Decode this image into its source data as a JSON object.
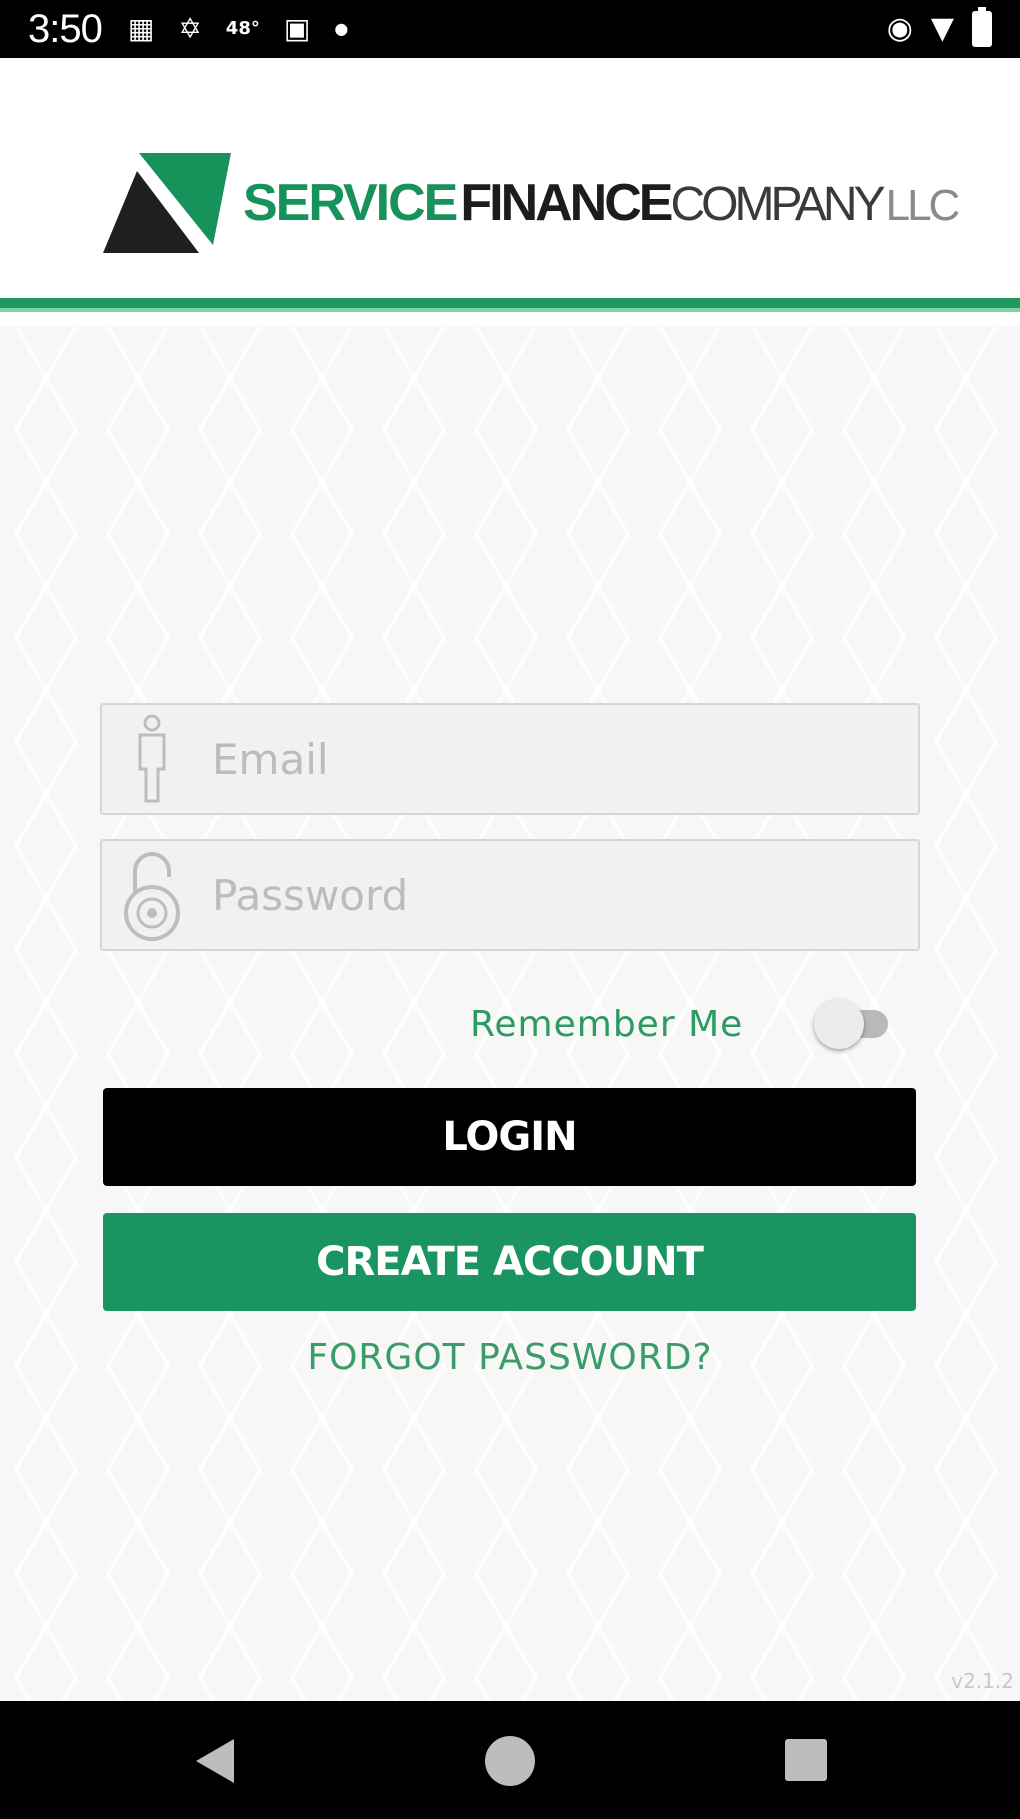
{
  "status_bar": {
    "time": "3:50",
    "temperature": "48°",
    "left_icons": [
      "notification-icon",
      "settings-icon",
      "temperature",
      "sim-icon",
      "dot-icon"
    ],
    "right_icons": [
      "eye-icon",
      "wifi-icon",
      "battery-icon"
    ]
  },
  "header": {
    "logo": {
      "word1": "SERVICE",
      "word2": "FINANCE",
      "word3": "COMPANY",
      "word4": "LLC"
    }
  },
  "colors": {
    "brand_green": "#1a9460",
    "accent_text_green": "#2e9a62",
    "login_button": "#000000"
  },
  "form": {
    "email": {
      "placeholder": "Email",
      "value": "",
      "icon": "person-icon"
    },
    "password": {
      "placeholder": "Password",
      "value": "",
      "icon": "padlock-icon"
    },
    "remember_me": {
      "label": "Remember Me",
      "checked": false
    },
    "login_label": "LOGIN",
    "create_account_label": "CREATE ACCOUNT",
    "forgot_password_label": "FORGOT PASSWORD?"
  },
  "version": "v2.1.2",
  "nav_bar": {
    "buttons": [
      "back-icon",
      "home-icon",
      "recents-icon"
    ]
  }
}
